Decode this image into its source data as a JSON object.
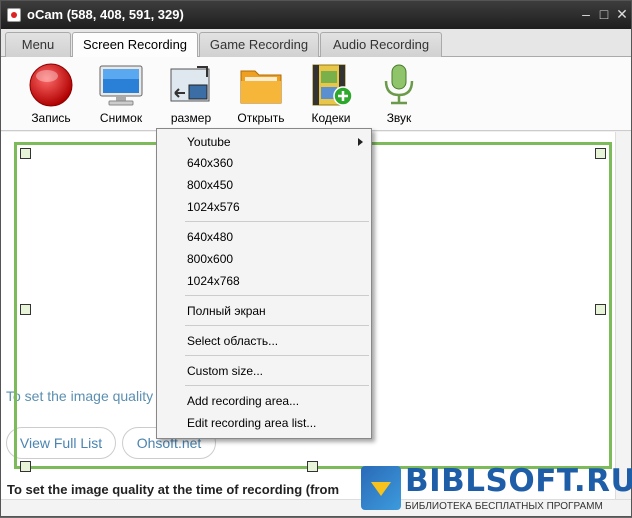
{
  "window": {
    "title": "oCam (588, 408, 591, 329)"
  },
  "titlebar_controls": {
    "minimize": "–",
    "maximize": "□",
    "close": "✕"
  },
  "tabs": [
    {
      "label": "Menu"
    },
    {
      "label": "Screen Recording"
    },
    {
      "label": "Game Recording"
    },
    {
      "label": "Audio Recording"
    }
  ],
  "toolbar": [
    {
      "label": "Запись",
      "icon": "record-icon"
    },
    {
      "label": "Снимок",
      "icon": "monitor-icon"
    },
    {
      "label": "размер",
      "icon": "resize-icon"
    },
    {
      "label": "Открыть",
      "icon": "folder-icon"
    },
    {
      "label": "Кодеки",
      "icon": "film-plus-icon"
    },
    {
      "label": "Звук",
      "icon": "microphone-icon"
    }
  ],
  "background": {
    "quality_text": "To set the image quality",
    "view_full_list": "View Full List",
    "ohsoft": "Ohsoft.net",
    "bottom_text": "To set the image quality at the time of recording (from"
  },
  "menu": {
    "items": [
      "Youtube",
      "640x360",
      "800x450",
      "1024x576",
      "640x480",
      "800x600",
      "1024x768",
      "Полный экран",
      "Select область...",
      "Custom size...",
      "Add recording area...",
      "Edit recording area list..."
    ]
  },
  "watermark": {
    "big": "BIBLSOFT.RU",
    "small": "БИБЛИОТЕКА БЕСПЛАТНЫХ ПРОГРАММ"
  },
  "colors": {
    "frame_green": "#7dbb5a",
    "record_red": "#d21a1a",
    "link_blue": "#4a84b0"
  }
}
